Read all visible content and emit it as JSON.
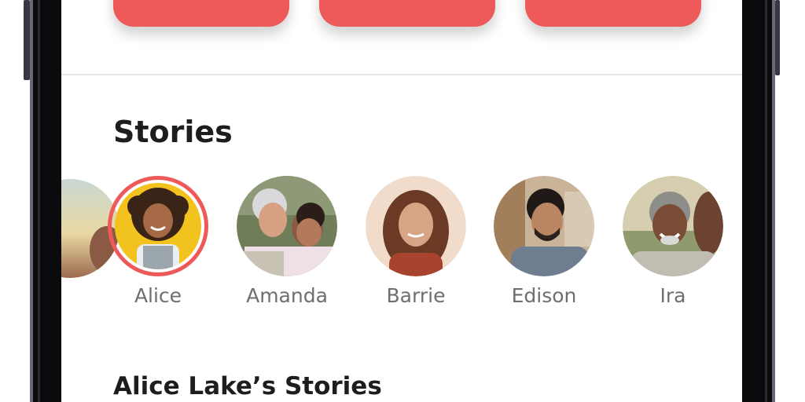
{
  "stories_section": {
    "title": "Stories",
    "people": [
      {
        "name": "Alice",
        "selected": true
      },
      {
        "name": "Amanda",
        "selected": false
      },
      {
        "name": "Barrie",
        "selected": false
      },
      {
        "name": "Edison",
        "selected": false
      },
      {
        "name": "Ira",
        "selected": false
      }
    ]
  },
  "subsection": {
    "title": "Alice Lake’s Stories"
  },
  "colors": {
    "accent": "#ee5a59",
    "title_text": "#1d1d1f",
    "label_text": "#6e6e6e",
    "divider": "#e6e6e6"
  }
}
